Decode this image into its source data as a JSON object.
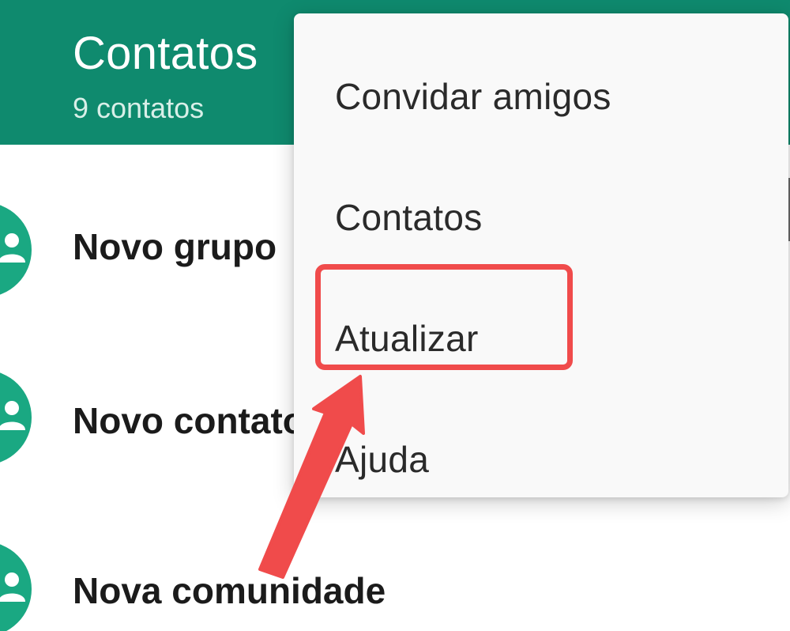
{
  "header": {
    "title": "Contatos",
    "subtitle": "9 contatos"
  },
  "list": {
    "items": [
      {
        "label": "Novo grupo",
        "icon": "group-icon"
      },
      {
        "label": "Novo contato",
        "icon": "add-contact-icon"
      },
      {
        "label": "Nova comunidade",
        "icon": "community-icon"
      }
    ]
  },
  "menu": {
    "items": [
      {
        "label": "Convidar amigos"
      },
      {
        "label": "Contatos"
      },
      {
        "label": "Atualizar"
      },
      {
        "label": "Ajuda"
      }
    ],
    "highlighted": "Atualizar"
  },
  "colors": {
    "header_bg": "#0f8a6e",
    "avatar_bg": "#1aa882",
    "menu_bg": "#f9f9f9",
    "annotation": "#f04b4b"
  }
}
